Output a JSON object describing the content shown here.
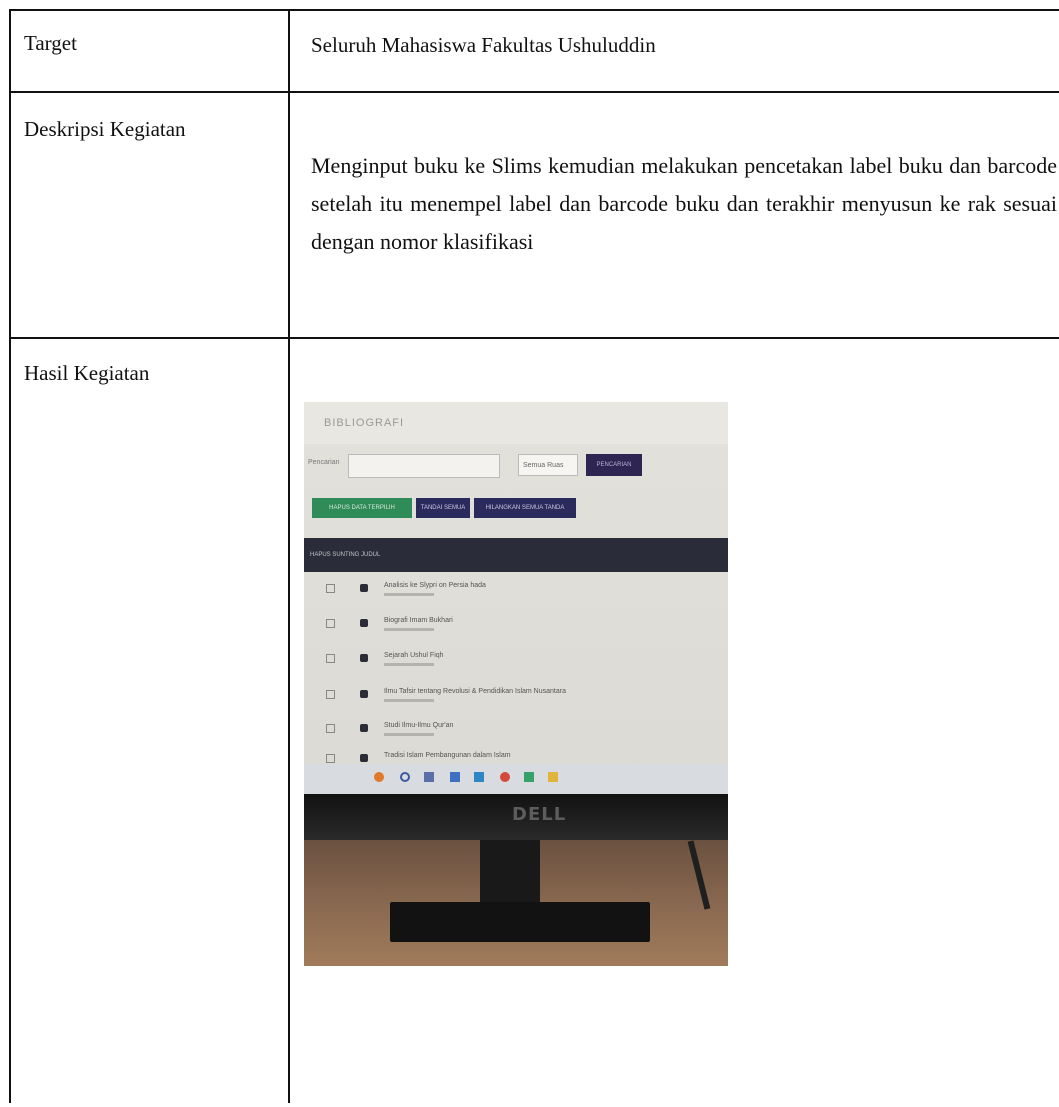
{
  "rows": [
    {
      "label": "Target",
      "value": "Seluruh Mahasiswa Fakultas Ushuluddin"
    },
    {
      "label": "Deskripsi Kegiatan",
      "value": "Menginput buku ke Slims kemudian melakukan pencetakan label buku dan barcode setelah itu menempel label dan barcode buku dan terakhir menyusun ke rak sesuai dengan nomor klasifikasi"
    },
    {
      "label": "Hasil Kegiatan",
      "value": ""
    }
  ],
  "photo": {
    "screen_title": "BIBLIOGRAFI",
    "search_label": "Pencarian",
    "select_value": "Semua Ruas",
    "find_button": "PENCARIAN",
    "buttons": [
      "HAPUS DATA TERPILIH",
      "TANDAI SEMUA",
      "HILANGKAN SEMUA TANDA"
    ],
    "table_header": "HAPUS  SUNTING  JUDUL",
    "items": [
      "Analisis ke Slypri on Persia hada",
      "Biografi Imam Bukhari",
      "Sejarah Ushul Fiqh",
      "Ilmu Tafsir tentang Revolusi & Pendidikan Islam Nusantara",
      "Studi Ilmu-Ilmu Qur'an",
      "Tradisi Islam Pembangunan dalam Islam"
    ],
    "monitor_brand": "DELL"
  }
}
